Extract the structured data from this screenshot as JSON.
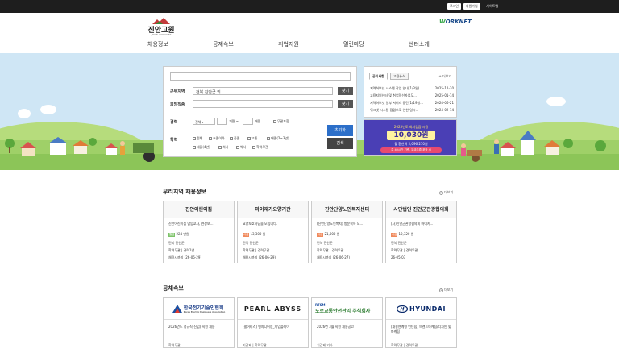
{
  "top_links": {
    "login": "로그인",
    "join": "회원가입",
    "sitemap": "+ 사이트맵"
  },
  "logo": {
    "title": "진안고원",
    "sub": "JINAN WORKNET"
  },
  "worknet": {
    "prefix": "W",
    "name": "ORKNET"
  },
  "nav": [
    "채용정보",
    "공제속보",
    "취업지원",
    "열린마당",
    "센터소개"
  ],
  "search": {
    "region_label": "근무지역",
    "region_value": "전북 진안군 외",
    "find": "찾기",
    "job_label": "희망직종",
    "find2": "찾기",
    "career_label": "경력",
    "career_select": "전체",
    "career_from": "개월 ~",
    "career_to": "개월",
    "career_none": "무관포함",
    "edu_label": "학력",
    "edu_options": [
      "전체",
      "초졸이하",
      "중졸",
      "고졸",
      "대졸(2~3년)",
      "대졸(4년)",
      "석사",
      "박사",
      "학력무관"
    ],
    "reset": "초기화",
    "submit": "검색"
  },
  "notice": {
    "tabs": [
      "공지사항",
      "고용뉴스"
    ],
    "more": "+ 더보기",
    "rows": [
      {
        "title": "지역허브넷 시스템 작업 안내(1/3일)...",
        "date": "2025-12-30"
      },
      {
        "title": "고용지원센터 및 취업알선자업무...",
        "date": "2025-01-14"
      },
      {
        "title": "지역허브넷 일부 서비스 중단(1/19일...",
        "date": "2024-06-21"
      },
      {
        "title": "워크넷 시스템 점검으로 인한 일시...",
        "date": "2024-02-14"
      }
    ]
  },
  "banner": {
    "line1": "2025년도 최저임금 시급",
    "amount": "10,030원",
    "line2": "월 환산액 2,096,270원",
    "line3": "주 40시간 기준, 유급주휴 포함 시"
  },
  "jobs": {
    "title": "우리지역 채용정보",
    "more": "더보기",
    "cards": [
      {
        "name": "진안어린이집",
        "desc": "진안어린이집 담임교사, 연장보...",
        "pay_tag": "월급",
        "pay": "224 만원",
        "loc": "전북 진안군",
        "cond": "학력무관 | 경력1년",
        "until": "채용시까지 (26-06-29)"
      },
      {
        "name": "마이재가요양기관",
        "desc": "요양보호사님을 모십니다.",
        "pay_tag": "시급",
        "pay": "13,300 원",
        "loc": "전북 진안군",
        "cond": "학력무관 | 경력무관",
        "until": "채용시까지 (26-06-29)"
      },
      {
        "name": "진안단양노인복지센터",
        "desc": "(진안단양노인복지) 방문목욕 요...",
        "pay_tag": "시급",
        "pay": "21,000 원",
        "loc": "전북 진안군",
        "cond": "학력무관 | 경력무관",
        "until": "채용시까지 (26-06-27)"
      },
      {
        "name": "사단법인 진안군관광협의회",
        "desc": "[사)진안군관광협의회 마이키...",
        "pay_tag": "시급",
        "pay": "10,320 원",
        "loc": "전북 진안군",
        "cond": "학력무관 | 경력무관",
        "until": "26-05-03"
      }
    ]
  },
  "gongche": {
    "title": "공채속보",
    "more": "더보기",
    "cards": [
      {
        "logo": "한국전기기술인협회",
        "logo_sub": "Korea Electric Engineers Association",
        "title": "2026년도 정규직(신입) 직원 채용",
        "foot": "학력무관"
      },
      {
        "logo": "PEARL ABYSS",
        "logo_sub": "",
        "title": "[펄어비스] 엔지니어링_게임플레이",
        "foot": "기간제 | 학력무관"
      },
      {
        "logo": "도로교통안전관리 주식회사",
        "logo_sub": "RTSM",
        "title": "2026년 3월 직원 채용공고",
        "foot": "기간제 기타"
      },
      {
        "logo": "HYUNDAI",
        "logo_sub": "",
        "title": "[채용연계형 인턴십] 브랜드아케팅/디자인 및 마케팅",
        "foot": "학력무관 | 경력무관"
      }
    ]
  }
}
